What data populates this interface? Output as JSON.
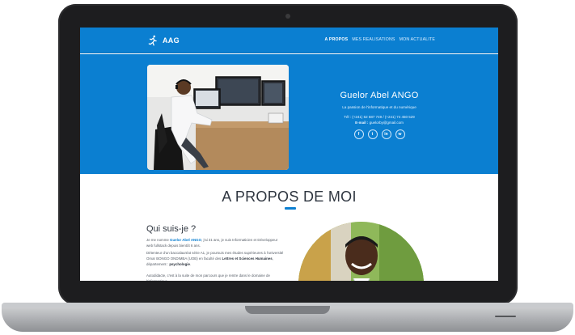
{
  "nav": {
    "brand": "AAG",
    "links": [
      {
        "label": "A PROPOS",
        "active": true
      },
      {
        "label": "MES REALISATIONS",
        "active": false
      },
      {
        "label": "MON ACTUALITE",
        "active": false
      }
    ]
  },
  "hero": {
    "name": "Guelor Abel ANGO",
    "tagline": "La passion de l'informatique et du numérique",
    "tel_label": "Tél :",
    "tel_value": "(+241) 62 687 749 / (+241) 74 450 529",
    "email_label": "E-mail :",
    "email_value": "guelorby@gmail.com",
    "socials": [
      {
        "icon": "facebook-icon",
        "glyph": "f"
      },
      {
        "icon": "twitter-icon",
        "glyph": "t"
      },
      {
        "icon": "linkedin-icon",
        "glyph": "in"
      },
      {
        "icon": "whatsapp-icon",
        "glyph": "w"
      }
    ]
  },
  "about": {
    "title": "A PROPOS DE MOI",
    "heading": "Qui suis-je ?",
    "p1_a": "Je me nomme ",
    "p1_name": "Guelor Abel ANGO",
    "p1_b": ", j'ai 31 ans, je suis Informaticien et Développeur web fullstack depuis bientôt 6 ans.",
    "p2_a": "Détenteur d'un baccalauréat série A1, je poursuis mes études supérieures à l'université Omar BONGO ONDIMBA (UOB) en faculté des ",
    "p2_fac": "Lettres et Sciences Humaines",
    "p2_b": ", département : ",
    "p2_dep": "psychologie",
    "p2_c": ".",
    "p3": "Autodidacte, c'est à la suite de mon parcours que je rentre dans le domaine de l'informatique"
  },
  "colors": {
    "primary": "#0b7fd1",
    "heading": "#2f3640"
  }
}
